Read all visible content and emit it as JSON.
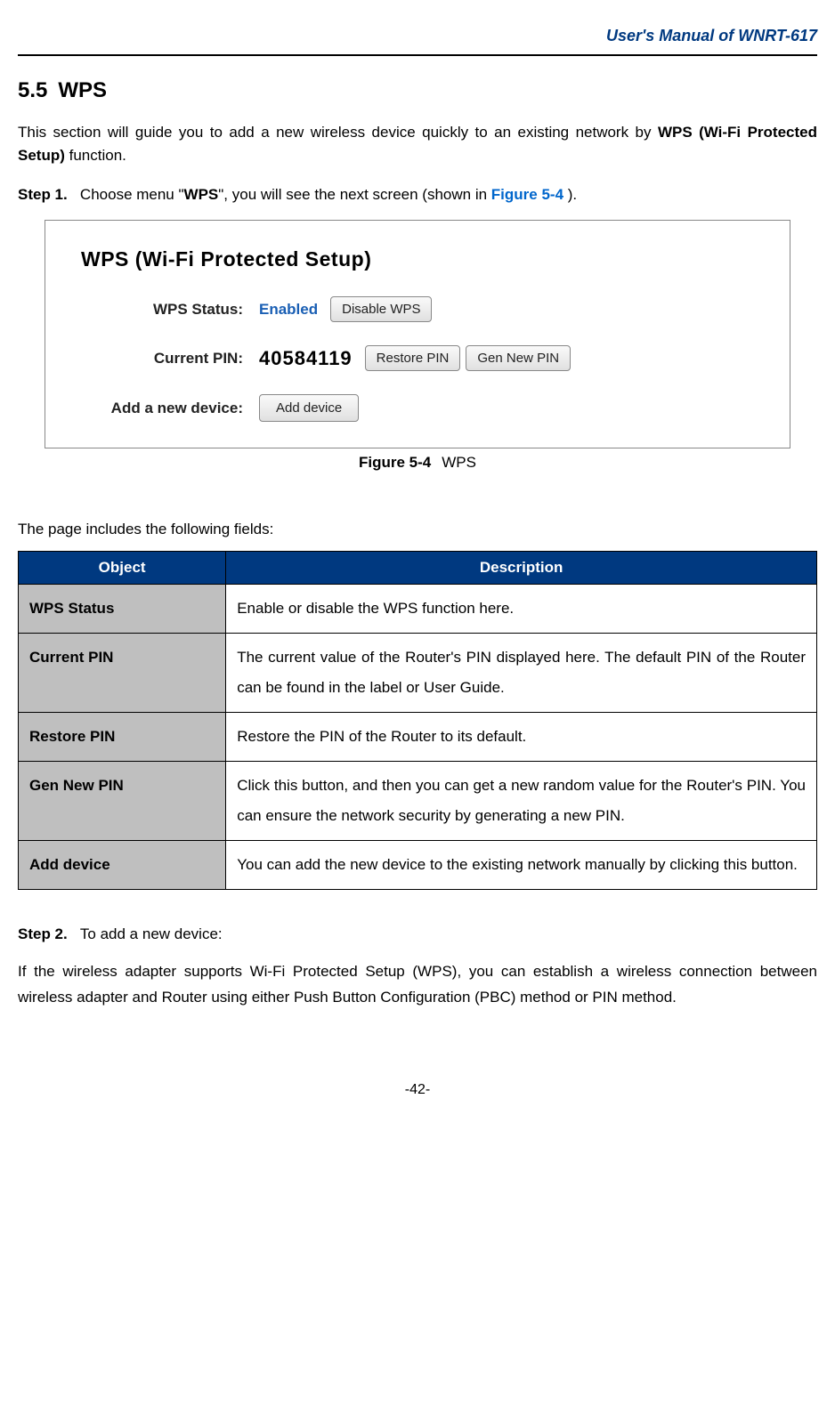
{
  "header": {
    "title": "User's Manual of WNRT-617"
  },
  "section": {
    "number": "5.5",
    "title": "WPS"
  },
  "intro": {
    "prefix": "This section will guide you to add a new wireless device quickly to an existing network by ",
    "bold": "WPS (Wi-Fi Protected Setup)",
    "suffix": " function."
  },
  "step1": {
    "label": "Step 1.",
    "p1": "Choose menu \"",
    "bold": "WPS",
    "p2": "\", you will see the next screen (shown in ",
    "ref": "Figure 5-4",
    "p3": " )."
  },
  "figure": {
    "title": "WPS (Wi-Fi Protected Setup)",
    "rows": {
      "status_label": "WPS Status:",
      "status_value": "Enabled",
      "disable_btn": "Disable WPS",
      "pin_label": "Current PIN:",
      "pin_value": "40584119",
      "restore_btn": "Restore PIN",
      "gen_btn": "Gen New PIN",
      "add_label": "Add a new device:",
      "add_btn": "Add device"
    },
    "caption_label": "Figure 5-4",
    "caption_text": "WPS"
  },
  "fields_intro": "The page includes the following fields:",
  "table": {
    "headers": {
      "object": "Object",
      "description": "Description"
    },
    "rows": [
      {
        "obj": "WPS Status",
        "desc": "Enable or disable the WPS function here."
      },
      {
        "obj": "Current PIN",
        "desc": "The current value of the Router's PIN displayed here. The default PIN of the Router can be found in the label or User Guide."
      },
      {
        "obj": "Restore PIN",
        "desc": "Restore the PIN of the Router to its default."
      },
      {
        "obj": "Gen New PIN",
        "desc": "Click this button, and then you can get a new random value for the Router's PIN. You can ensure the network security by generating a new PIN."
      },
      {
        "obj": "Add device",
        "desc": "You can add the new device to the existing network manually by clicking this button."
      }
    ]
  },
  "step2": {
    "label": "Step 2.",
    "text": "To add a new device:",
    "body": "If the wireless adapter supports Wi-Fi Protected Setup (WPS), you can establish a wireless connection between wireless adapter and Router using either Push Button Configuration (PBC) method or PIN method."
  },
  "footer": {
    "page": "-42-"
  }
}
